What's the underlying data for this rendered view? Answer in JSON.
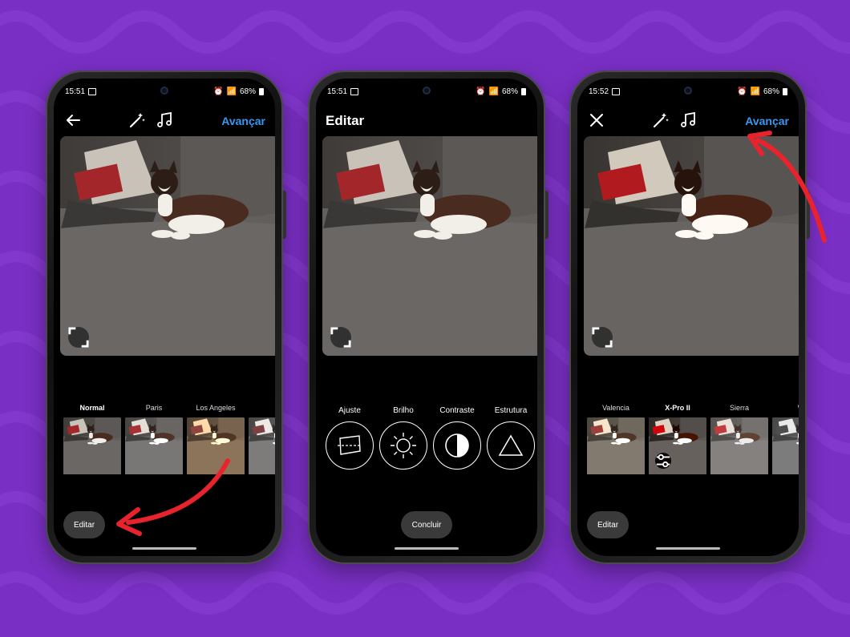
{
  "colors": {
    "background": "#7a2fc4",
    "accent_link": "#3897f0",
    "arrow": "#e8232d"
  },
  "phones": [
    {
      "status": {
        "time": "15:51",
        "battery": "68%"
      },
      "topbar": {
        "next_label": "Avançar"
      },
      "filters": [
        {
          "name": "Normal",
          "active": true
        },
        {
          "name": "Paris",
          "active": false
        },
        {
          "name": "Los Angeles",
          "active": false
        },
        {
          "name": "R",
          "active": false
        }
      ],
      "action_label": "Editar"
    },
    {
      "status": {
        "time": "15:51",
        "battery": "68%"
      },
      "topbar": {
        "title": "Editar"
      },
      "tools": [
        {
          "name": "Ajuste",
          "icon": "crop-straighten-icon"
        },
        {
          "name": "Brilho",
          "icon": "sun-icon"
        },
        {
          "name": "Contraste",
          "icon": "contrast-icon"
        },
        {
          "name": "Estrutura",
          "icon": "triangle-icon"
        }
      ],
      "action_label": "Concluir"
    },
    {
      "status": {
        "time": "15:52",
        "battery": "68%"
      },
      "topbar": {
        "next_label": "Avançar"
      },
      "filters": [
        {
          "name": "Valencia",
          "active": false
        },
        {
          "name": "X-Pro II",
          "active": true
        },
        {
          "name": "Sierra",
          "active": false
        },
        {
          "name": "W",
          "active": false
        }
      ],
      "action_label": "Editar"
    }
  ]
}
